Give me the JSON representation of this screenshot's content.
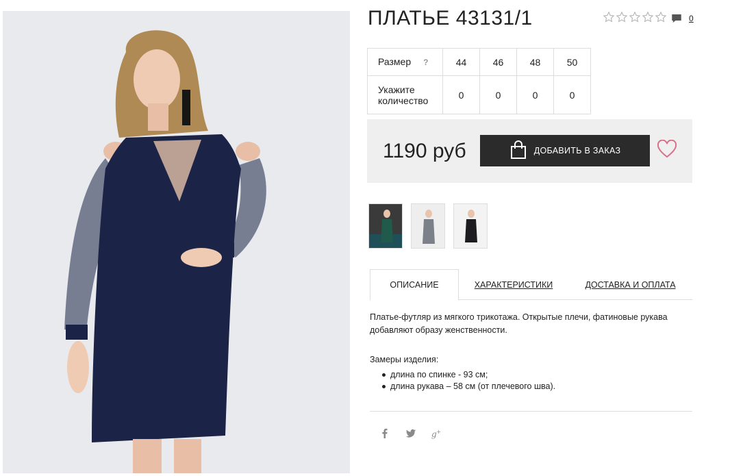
{
  "product": {
    "title": "ПЛАТЬЕ 43131/1",
    "rating": {
      "value": 0,
      "max": 5
    },
    "comments_count": "0",
    "price": "1190 руб",
    "add_to_cart_label": "ДОБАВИТЬ В ЗАКАЗ"
  },
  "size_table": {
    "size_label": "Размер",
    "help_label": "?",
    "quantity_label": "Укажите количество",
    "sizes": [
      "44",
      "46",
      "48",
      "50"
    ],
    "quantities": [
      "0",
      "0",
      "0",
      "0"
    ]
  },
  "tabs": [
    {
      "label": "ОПИСАНИЕ",
      "active": true
    },
    {
      "label": "ХАРАКТЕРИСТИКИ",
      "active": false
    },
    {
      "label": "ДОСТАВКА И ОПЛАТА",
      "active": false
    }
  ],
  "description": {
    "text": "Платье-футляр из мягкого трикотажа. Открытые плечи, фатиновые рукава добавляют образу женственности.",
    "measurements_title": "Замеры изделия:",
    "measurements": [
      "длина по спинке - 93 см;",
      "длина рукава – 58 см (от плечевого шва)."
    ]
  },
  "social": [
    {
      "icon": "facebook-icon",
      "glyph": "f"
    },
    {
      "icon": "twitter-icon",
      "glyph": "t"
    },
    {
      "icon": "google-plus-icon",
      "glyph": "g+"
    }
  ],
  "thumbnails": [
    {
      "name": "thumbnail-green-dress",
      "dress_color": "#1f5a4a",
      "bg": "#3a3a3a"
    },
    {
      "name": "thumbnail-grey-dress",
      "dress_color": "#7b8089",
      "bg": "#eeeeee"
    },
    {
      "name": "thumbnail-black-dress",
      "dress_color": "#1d1d1f",
      "bg": "#f3f3f3"
    }
  ],
  "colors": {
    "accent_dark": "#2b2b2b",
    "buybox_bg": "#efefef",
    "heart": "#d8708a",
    "dress_navy": "#1b2447",
    "photo_bg": "#e9eaee"
  }
}
